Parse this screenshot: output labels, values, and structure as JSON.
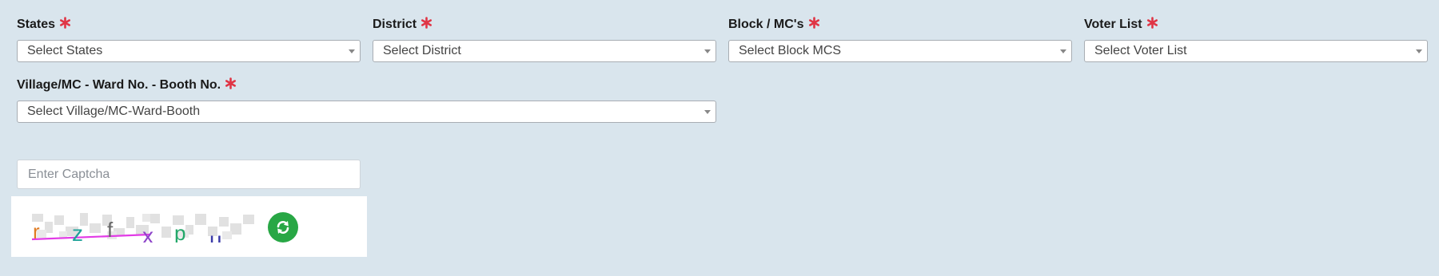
{
  "form": {
    "states": {
      "label": "States",
      "placeholder": "Select States"
    },
    "district": {
      "label": "District",
      "placeholder": "Select District"
    },
    "block": {
      "label": "Block / MC's",
      "placeholder": "Select Block MCS"
    },
    "voter_list": {
      "label": "Voter List",
      "placeholder": "Select Voter List"
    },
    "village": {
      "label": "Village/MC - Ward No. - Booth No.",
      "placeholder": "Select Village/MC-Ward-Booth"
    }
  },
  "captcha": {
    "input_placeholder": "Enter Captcha",
    "characters": [
      "r",
      "z",
      "f",
      "x",
      "p",
      "u"
    ],
    "refresh_icon": "refresh-icon"
  },
  "colors": {
    "background": "#d9e5ed",
    "required": "#e03545",
    "refresh": "#28a745"
  }
}
